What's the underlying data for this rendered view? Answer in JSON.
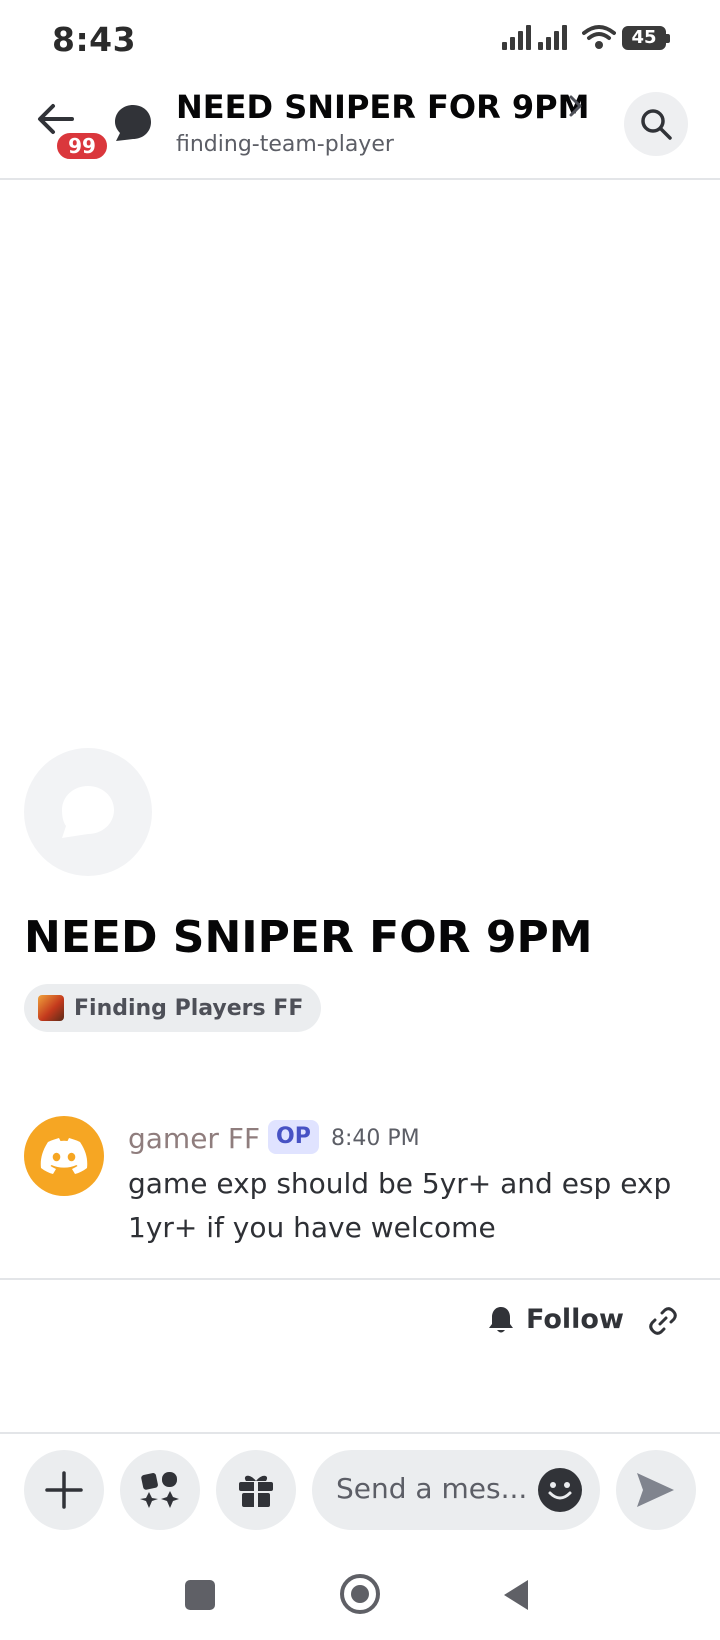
{
  "status_bar": {
    "time": "8:43",
    "battery": "45",
    "icons": [
      "signal-icon",
      "signal-icon",
      "wifi-icon",
      "battery-icon"
    ]
  },
  "header": {
    "unread_badge": "99",
    "title": "NEED SNIPER FOR 9PM",
    "channel": "finding-team-player",
    "icons": [
      "back-arrow-icon",
      "thread-bubble-icon",
      "chevron-right-icon",
      "search-icon"
    ]
  },
  "thread": {
    "title": "NEED SNIPER FOR 9PM",
    "tag": "Finding Players FF"
  },
  "message": {
    "author": "gamer FF",
    "op_badge": "OP",
    "time": "8:40 PM",
    "text": "game exp should be 5yr+ and esp exp 1yr+ if you have welcome"
  },
  "actions": {
    "follow_label": "Follow",
    "icons": [
      "bell-icon",
      "link-icon"
    ]
  },
  "composer": {
    "placeholder": "Send a mes...",
    "icons": [
      "plus-icon",
      "apps-icon",
      "gift-icon",
      "emoji-icon",
      "send-icon"
    ]
  },
  "colors": {
    "badge_red": "#da373c",
    "avatar_orange": "#f6a623",
    "op_bg": "#e0e3ff",
    "op_text": "#4752c4",
    "author": "#8f7d7d"
  }
}
